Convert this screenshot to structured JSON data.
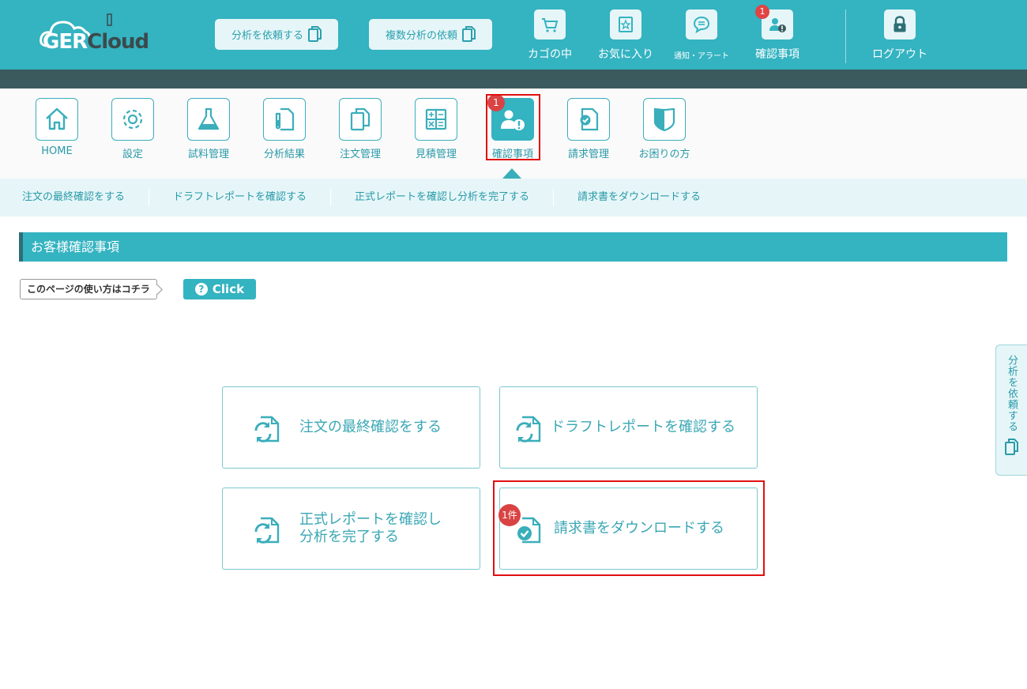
{
  "header": {
    "logo": {
      "brand_part1": "GER",
      "brand_part2": "Cloud"
    },
    "buttons": [
      {
        "label": "分析を依頼する",
        "icon": "copy-icon"
      },
      {
        "label": "複数分析の依頼",
        "icon": "copy-icon"
      }
    ],
    "items": [
      {
        "label": "カゴの中",
        "icon": "cart-icon"
      },
      {
        "label": "お気に入り",
        "icon": "star-icon"
      },
      {
        "label": "通知・アラート",
        "icon": "chat-bubble-icon"
      },
      {
        "label": "確認事項",
        "icon": "user-alert-icon",
        "badge": "1"
      }
    ],
    "logout": {
      "label": "ログアウト",
      "icon": "lock-icon"
    }
  },
  "nav": {
    "items": [
      {
        "label": "HOME",
        "icon": "home-icon"
      },
      {
        "label": "設定",
        "icon": "gear-icon"
      },
      {
        "label": "試料管理",
        "icon": "flask-icon"
      },
      {
        "label": "分析結果",
        "icon": "test-tube-doc-icon"
      },
      {
        "label": "注文管理",
        "icon": "copy-icon"
      },
      {
        "label": "見積管理",
        "icon": "calculator-icon"
      },
      {
        "label": "確認事項",
        "icon": "user-alert-icon",
        "badge": "1",
        "active": true
      },
      {
        "label": "請求管理",
        "icon": "check-doc-icon"
      },
      {
        "label": "お困りの方",
        "icon": "shield-icon"
      }
    ]
  },
  "subnav": {
    "items": [
      "注文の最終確認をする",
      "ドラフトレポートを確認する",
      "正式レポートを確認し分析を完了する",
      "請求書をダウンロードする"
    ]
  },
  "section": {
    "title": "お客様確認事項"
  },
  "help": {
    "label": "このページの使い方はコチラ",
    "button": "Click"
  },
  "cards": [
    {
      "label": "注文の最終確認をする",
      "icon": "refresh-doc-icon"
    },
    {
      "label": "ドラフトレポートを確認する",
      "icon": "refresh-doc-icon"
    },
    {
      "label": "正式レポートを確認し\n分析を完了する",
      "icon": "refresh-doc-icon"
    },
    {
      "label": "請求書をダウンロードする",
      "icon": "check-doc-icon",
      "badge": "1件"
    }
  ],
  "side_tab": {
    "label": "分析を依頼する",
    "icon": "copy-icon"
  },
  "colors": {
    "primary": "#34b3c1",
    "dark_bar": "#3a5a5e",
    "light": "#e6f6f8",
    "badge": "#d94343",
    "highlight": "#e01010"
  }
}
